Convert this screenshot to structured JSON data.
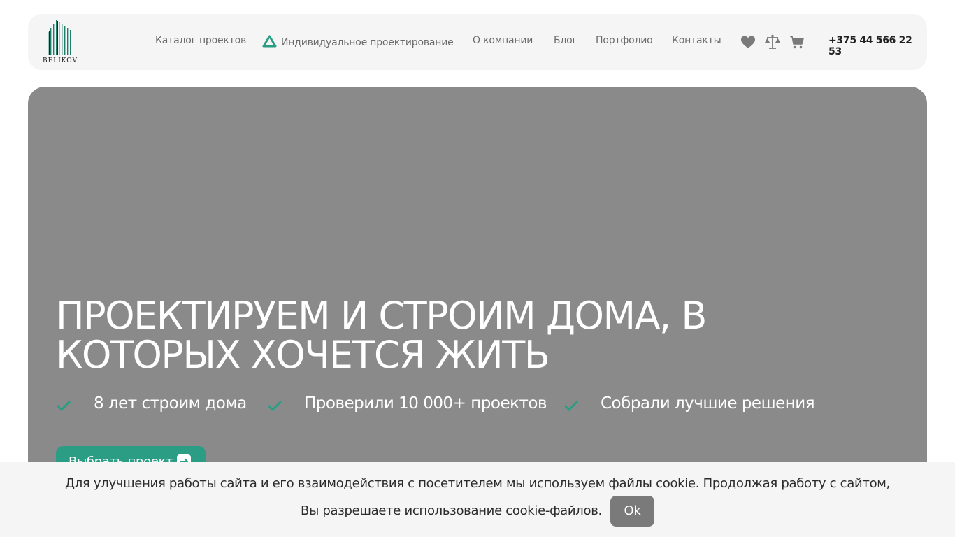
{
  "header": {
    "logo_text": "BELIKOV",
    "nav": [
      {
        "label": "Каталог проектов"
      },
      {
        "label": "Индивидуальное проектирование"
      },
      {
        "label": "О компании"
      },
      {
        "label": "Блог"
      },
      {
        "label": "Портфолио"
      },
      {
        "label": "Контакты"
      }
    ],
    "icons": [
      "heart-icon",
      "scales-icon",
      "cart-icon"
    ],
    "phone": "+375 44 566 22 53"
  },
  "hero": {
    "title": "Проектируем и строим дома, в которых хочется жить",
    "features": [
      "8 лет строим дома",
      "Проверили 10 000+ проектов",
      "Собрали лучшие решения"
    ],
    "cta_label": "Выбрать проект"
  },
  "cookie": {
    "text": "Для улучшения работы сайта и его взаимодействия с посетителем мы используем файлы cookie. Продолжая работу с сайтом, Вы разрешаете использование cookie-файлов.",
    "ok_label": "Ok"
  },
  "colors": {
    "accent": "#2a9d84",
    "header_bg": "#f5f5f5",
    "hero_bg": "#8a8a8a",
    "nav_text": "#6b6b6b"
  }
}
